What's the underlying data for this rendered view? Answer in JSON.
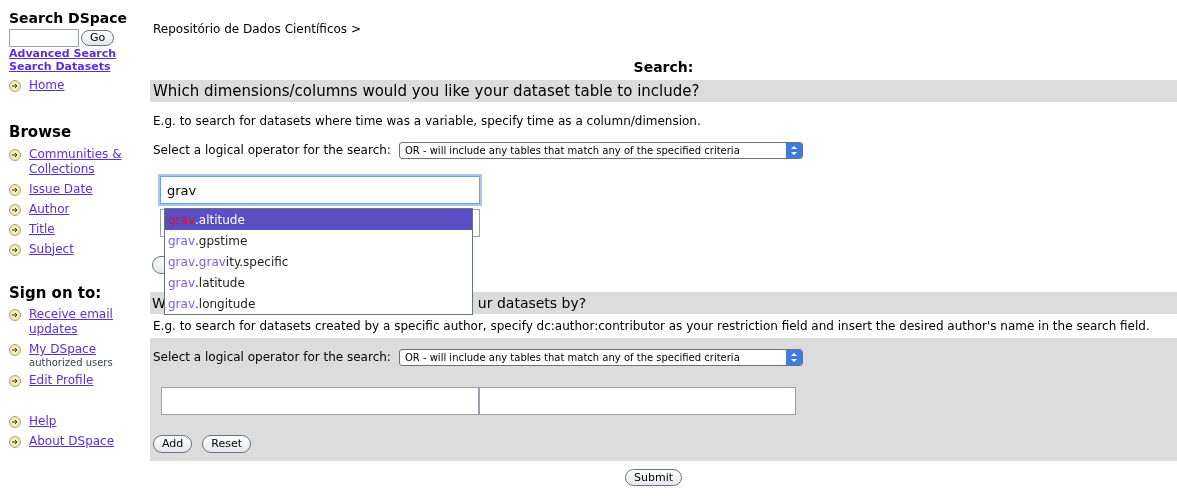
{
  "sidebar": {
    "search_title": "Search DSpace",
    "go_button": "Go",
    "bold_links": [
      "Advanced Search",
      "Search Datasets"
    ],
    "sections": [
      {
        "items": [
          {
            "label": "Home"
          }
        ]
      },
      {
        "title": "Browse",
        "items": [
          {
            "label": "Communities & Collections"
          },
          {
            "label": "Issue Date"
          },
          {
            "label": "Author"
          },
          {
            "label": "Title"
          },
          {
            "label": "Subject"
          }
        ]
      },
      {
        "title": "Sign on to:",
        "items": [
          {
            "label": "Receive email updates"
          },
          {
            "label": "My DSpace",
            "note": "authorized users"
          },
          {
            "label": "Edit Profile"
          }
        ]
      },
      {
        "items": [
          {
            "label": "Help"
          },
          {
            "label": "About DSpace"
          }
        ]
      }
    ]
  },
  "breadcrumb": "Repositório de Dados Científicos >",
  "page_title": "Search:",
  "columns_section": {
    "heading": "Which dimensions/columns would you like your dataset table to include?",
    "description": "E.g. to search for datasets where time was a variable, specify time as a column/dimension.",
    "operator_label": "Select a logical operator for the search:",
    "operator_value": "OR - will include any tables that match any of the specified criteria",
    "field": {
      "value": "grav",
      "focused": true
    }
  },
  "autocomplete": [
    {
      "selected": true,
      "parts": [
        {
          "text": "grav",
          "matched": true
        },
        {
          "text": ".altitude",
          "matched": false
        }
      ]
    },
    {
      "selected": false,
      "parts": [
        {
          "text": "grav",
          "matched": true
        },
        {
          "text": ".gpstime",
          "matched": false
        }
      ]
    },
    {
      "selected": false,
      "parts": [
        {
          "text": "grav",
          "matched": true
        },
        {
          "text": ".",
          "matched": false
        },
        {
          "text": "grav",
          "matched": true
        },
        {
          "text": "ity.specific",
          "matched": false
        }
      ]
    },
    {
      "selected": false,
      "parts": [
        {
          "text": "grav",
          "matched": true
        },
        {
          "text": ".latitude",
          "matched": false
        }
      ]
    },
    {
      "selected": false,
      "parts": [
        {
          "text": "grav",
          "matched": true
        },
        {
          "text": ".longitude",
          "matched": false
        }
      ]
    }
  ],
  "restrict_section": {
    "heading_start": "W",
    "heading_end": "ur datasets by?",
    "description": "E.g. to search for datasets created by a specific author, specify dc:author:contributor as your restriction field and insert the desired author's name in the search field.",
    "operator_label": "Select a logical operator for the search:",
    "operator_value": "OR - will include any tables that match any of the specified criteria",
    "buttons": [
      "Add",
      "Reset"
    ]
  },
  "submit": "Submit"
}
